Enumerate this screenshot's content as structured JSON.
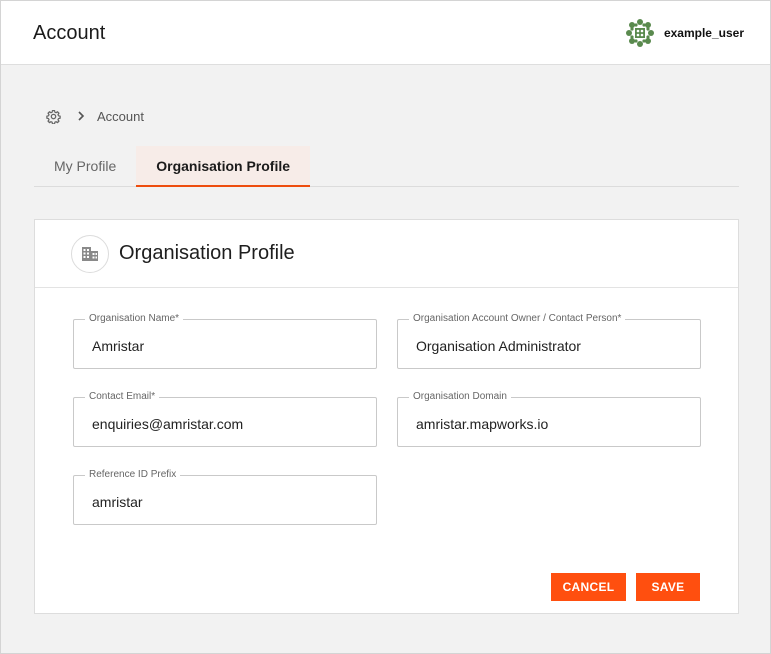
{
  "header": {
    "title": "Account",
    "username": "example_user"
  },
  "breadcrumb": {
    "items": [
      "Account"
    ]
  },
  "tabs": [
    {
      "label": "My Profile",
      "active": false
    },
    {
      "label": "Organisation Profile",
      "active": true
    }
  ],
  "card": {
    "title": "Organisation Profile"
  },
  "form": {
    "org_name": {
      "label": "Organisation Name*",
      "value": "Amristar"
    },
    "owner": {
      "label": "Organisation Account Owner / Contact Person*",
      "value": "Organisation Administrator"
    },
    "email": {
      "label": "Contact Email*",
      "value": "enquiries@amristar.com"
    },
    "domain": {
      "label": "Organisation Domain",
      "value": "amristar.mapworks.io"
    },
    "ref_prefix": {
      "label": "Reference ID Prefix",
      "value": "amristar"
    }
  },
  "actions": {
    "cancel_label": "CANCEL",
    "save_label": "SAVE"
  },
  "colors": {
    "accent": "#ff4f0f",
    "tab_active_bg": "#f7ece8",
    "avatar": "#5a8a4e"
  },
  "icons": {
    "avatar": "identicon-avatar",
    "breadcrumb_home": "gear-icon",
    "breadcrumb_sep": "chevron-right-icon",
    "card": "building-icon"
  }
}
